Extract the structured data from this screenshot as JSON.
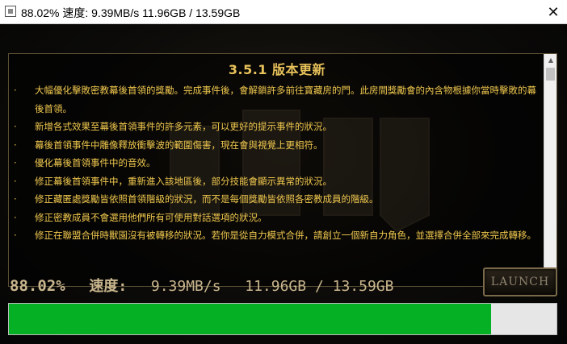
{
  "window": {
    "title": "88.02%  速度: 9.39MB/s  11.96GB / 13.59GB",
    "close_glyph": "✕"
  },
  "notes": {
    "title": "3.5.1 版本更新",
    "bullet": "·",
    "items": [
      "大幅優化擊敗密教幕後首領的獎勵。完成事件後，會解鎖許多前往寶藏房的門。此房間獎勵會的內含物根據你當時擊敗的幕後首領。",
      "新增各式效果至幕後首領事件的許多元素，可以更好的提示事件的狀況。",
      "幕後首領事件中雕像釋放衝擊波的範圍傷害，現在會與視覺上更相符。",
      "優化幕後首領事件中的音效。",
      "修正幕後首領事件中，重新進入該地區後，部分技能會顯示異常的狀況。",
      "修正藏匿處獎勵皆依照首領階級的狀況，而不是每個獎勵皆依照各密教成員的階級。",
      "修正密教成員不會選用他們所有可使用對話選項的狀況。",
      "修正在聯盟合併時獸園沒有被轉移的狀況。若你是從自力模式合併，請創立一個新自力角色，並選擇合併全部來完成轉移。"
    ]
  },
  "status": {
    "percent": "88.02%",
    "speed_label": "速度:",
    "speed": "9.39MB/s",
    "size": "11.96GB / 13.59GB"
  },
  "launch_label": "LAUNCH",
  "progress": {
    "fraction": 0.8802,
    "color": "#06b025"
  },
  "colors": {
    "notes_text": "#f0c84e",
    "status_text": "#c9b68e"
  }
}
